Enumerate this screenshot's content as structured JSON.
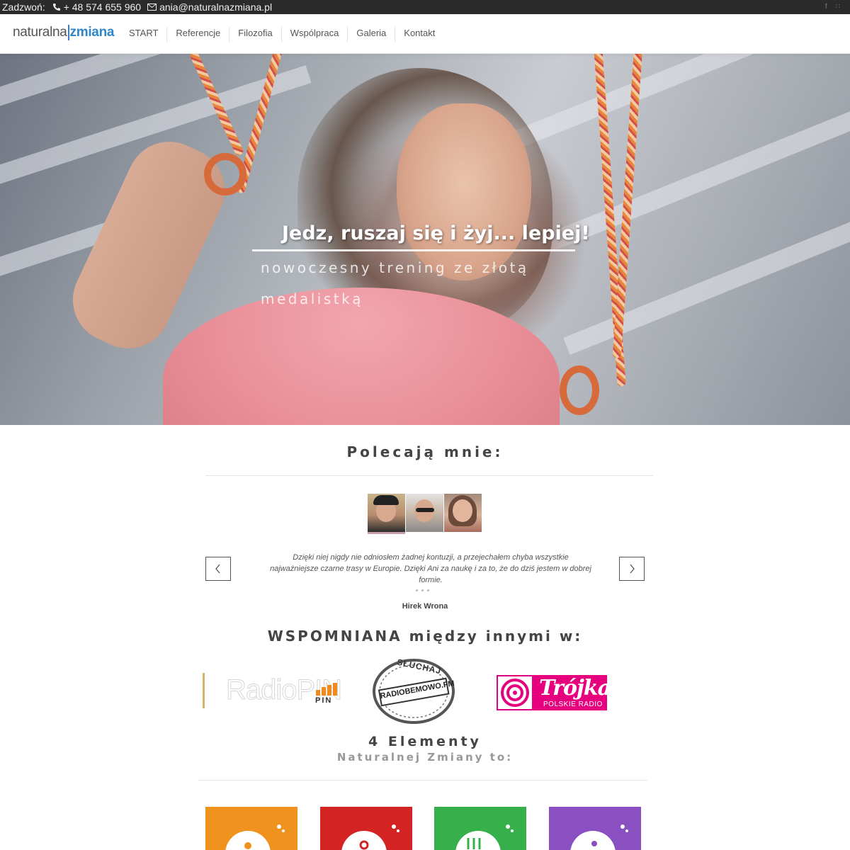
{
  "topbar": {
    "call_label": "Zadzwoń:",
    "phone": "+ 48 574 655 960",
    "email": "ania@naturalnazmiana.pl",
    "social": [
      "facebook-icon",
      "rss-icon"
    ]
  },
  "logo": {
    "part1": "naturalna",
    "part2": "zmiana"
  },
  "nav": [
    "START",
    "Referencje",
    "Filozofia",
    "Wspólpraca",
    "Galeria",
    "Kontakt"
  ],
  "hero": {
    "title": "Jedz, ruszaj się i żyj... lepiej!",
    "subtitle": "nowoczesny trening ze złotą medalistką"
  },
  "testimonials": {
    "heading": "Polecają mnie:",
    "quote": "Dzięki niej nigdy nie odniosłem żadnej kontuzji, a przejechałem chyba wszystkie najważniejsze czarne trasy w Europie. Dzięki Ani za naukę i za to, że do dziś jestem w dobrej formie.",
    "author": "Hirek Wrona"
  },
  "media": {
    "heading": "WSPOMNIANA między innymi w:",
    "radiopin": {
      "name": "RadioPIN",
      "tag": "PIN"
    },
    "bemowo": {
      "top": "SŁUCHAJ",
      "name": "RADIOBEMOWO.FM"
    },
    "trojka": {
      "name": "Trójka",
      "sub": "POLSKIE RADIO"
    }
  },
  "elements": {
    "heading1": "4 Elementy",
    "heading2": "Naturalnej Zmiany to:",
    "tiles": [
      {
        "color": "#f0931e"
      },
      {
        "color": "#d42323"
      },
      {
        "color": "#35b04a"
      },
      {
        "color": "#8a4fc1"
      }
    ]
  },
  "colors": {
    "brand_blue": "#2f86c9",
    "topbar_bg": "#2b2b2b",
    "trojka_pink": "#e6007e"
  }
}
